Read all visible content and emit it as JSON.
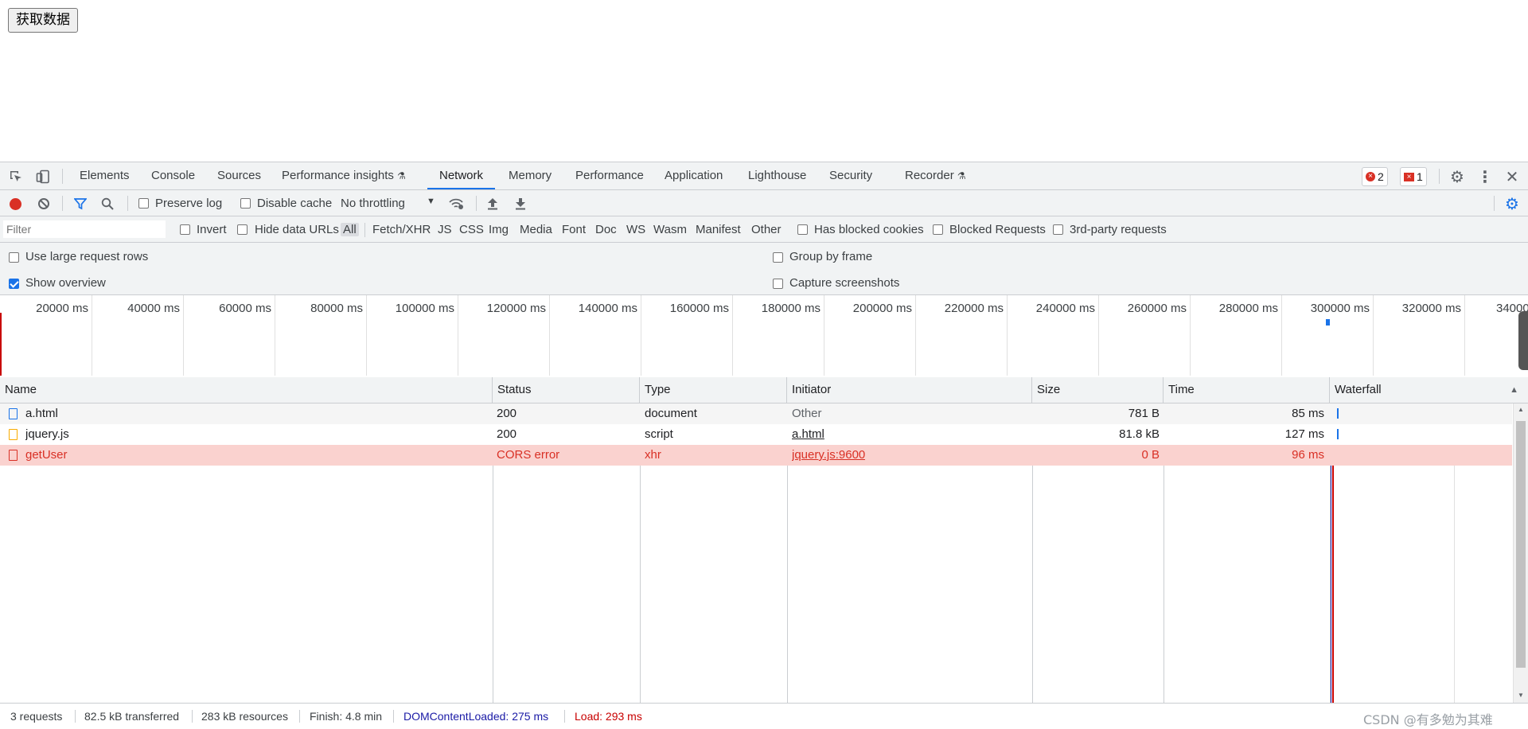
{
  "page": {
    "button_label": "获取数据"
  },
  "devtools": {
    "tabs": [
      "Elements",
      "Console",
      "Sources",
      "Performance insights",
      "Network",
      "Memory",
      "Performance",
      "Application",
      "Lighthouse",
      "Security",
      "Recorder"
    ],
    "active_tab": "Network",
    "error_count": "2",
    "issue_count": "1",
    "toolbar": {
      "preserve_log": "Preserve log",
      "disable_cache": "Disable cache",
      "throttling": "No throttling"
    },
    "filter": {
      "placeholder": "Filter",
      "invert": "Invert",
      "hide_data_urls": "Hide data URLs",
      "types": [
        "All",
        "Fetch/XHR",
        "JS",
        "CSS",
        "Img",
        "Media",
        "Font",
        "Doc",
        "WS",
        "Wasm",
        "Manifest",
        "Other"
      ],
      "selected_type": "All",
      "has_blocked_cookies": "Has blocked cookies",
      "blocked_requests": "Blocked Requests",
      "third_party": "3rd-party requests"
    },
    "settings": {
      "large_rows": "Use large request rows",
      "show_overview": "Show overview",
      "group_by_frame": "Group by frame",
      "capture_screenshots": "Capture screenshots"
    },
    "overview_ticks": [
      "20000 ms",
      "40000 ms",
      "60000 ms",
      "80000 ms",
      "100000 ms",
      "120000 ms",
      "140000 ms",
      "160000 ms",
      "180000 ms",
      "200000 ms",
      "220000 ms",
      "240000 ms",
      "260000 ms",
      "280000 ms",
      "300000 ms",
      "320000 ms",
      "34000"
    ],
    "columns": {
      "name": "Name",
      "status": "Status",
      "type": "Type",
      "initiator": "Initiator",
      "size": "Size",
      "time": "Time",
      "waterfall": "Waterfall"
    },
    "rows": [
      {
        "name": "a.html",
        "status": "200",
        "type": "document",
        "initiator": "Other",
        "size": "781 B",
        "time": "85 ms"
      },
      {
        "name": "jquery.js",
        "status": "200",
        "type": "script",
        "initiator": "a.html",
        "size": "81.8 kB",
        "time": "127 ms"
      },
      {
        "name": "getUser",
        "status": "CORS error",
        "type": "xhr",
        "initiator": "jquery.js:9600",
        "size": "0 B",
        "time": "96 ms"
      }
    ],
    "status_bar": {
      "requests": "3 requests",
      "transferred": "82.5 kB transferred",
      "resources": "283 kB resources",
      "finish": "Finish: 4.8 min",
      "dcl": "DOMContentLoaded: 275 ms",
      "load": "Load: 293 ms"
    },
    "watermark": "CSDN @有多勉为其难",
    "colors": {
      "accent": "#1a73e8",
      "error": "#d93025",
      "error_row_bg": "#fad2cf",
      "dcl": "#1a1aa6",
      "load": "#c80000"
    }
  }
}
